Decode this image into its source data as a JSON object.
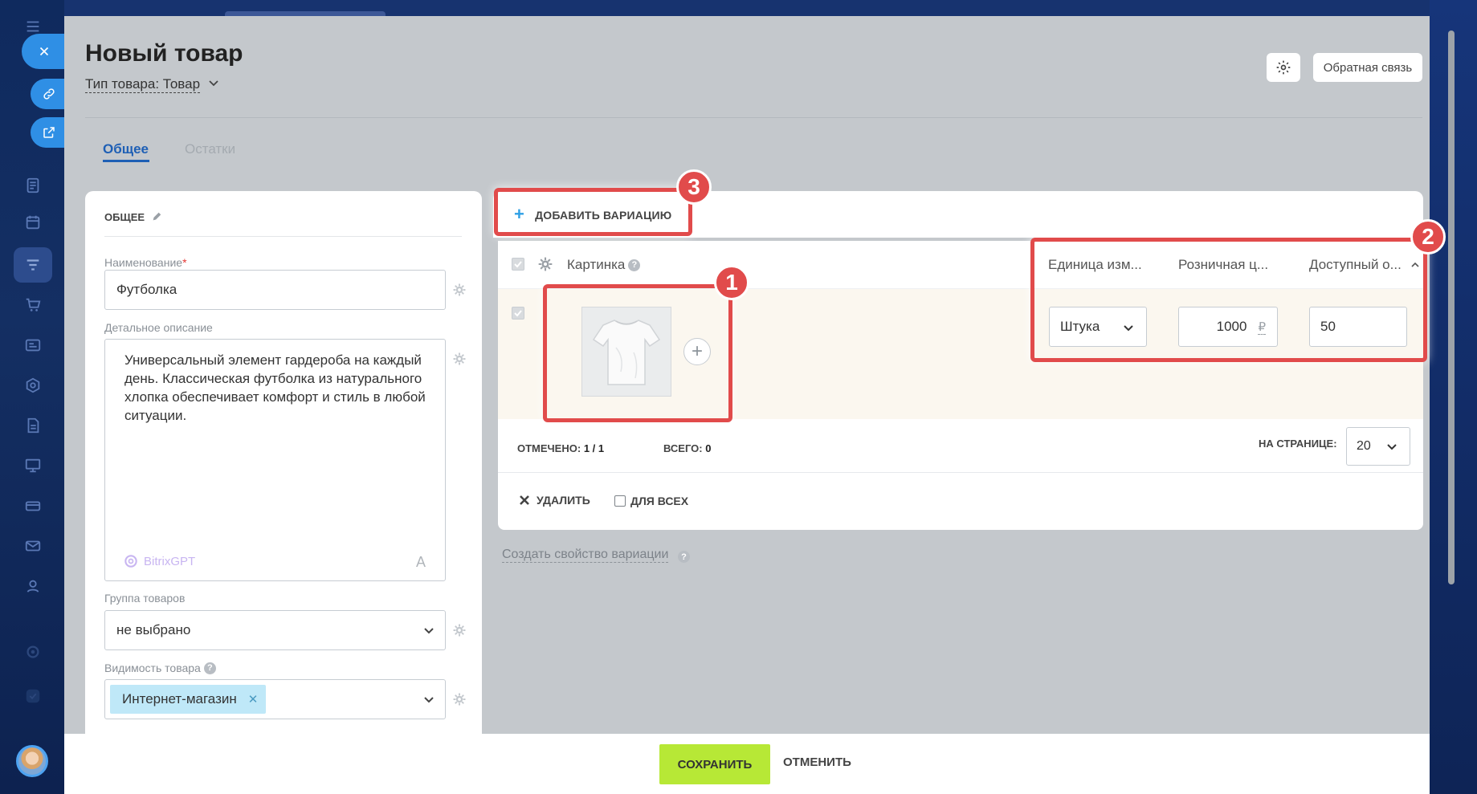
{
  "header": {
    "title": "Новый товар",
    "type_label": "Тип товара: Товар",
    "feedback_label": "Обратная связь"
  },
  "tabs": [
    {
      "label": "Общее",
      "active": true
    },
    {
      "label": "Остатки",
      "active": false
    }
  ],
  "general": {
    "section_title": "ОБЩЕЕ",
    "name_label": "Наименование",
    "name_required_mark": "*",
    "name_value": "Футболка",
    "description_label": "Детальное описание",
    "description_value": "Универсальный элемент гардероба на каждый день. Классическая футболка из натурального хлопка обеспечивает комфорт и стиль в любой ситуации.",
    "gpt_label": "BitrixGPT",
    "gpt_font_glyph": "A",
    "group_label": "Группа товаров",
    "group_value": "не выбрано",
    "visibility_label": "Видимость товара",
    "visibility_tag": "Интернет-магазин"
  },
  "variations": {
    "add_label": "ДОБАВИТЬ ВАРИАЦИЮ",
    "columns": {
      "picture": "Картинка",
      "unit": "Единица изм...",
      "price": "Розничная ц...",
      "available": "Доступный о..."
    },
    "row": {
      "unit": "Штука",
      "price": "1000",
      "currency": "₽",
      "available": "50"
    },
    "checked_label": "ОТМЕЧЕНО:",
    "checked_value": "1 / 1",
    "total_label": "ВСЕГО:",
    "total_value": "0",
    "per_page_label": "НА СТРАНИЦЕ:",
    "per_page_value": "20",
    "delete_label": "УДАЛИТЬ",
    "for_all_label": "ДЛЯ ВСЕХ",
    "create_property_label": "Создать свойство вариации"
  },
  "footer": {
    "save_label": "СОХРАНИТЬ",
    "cancel_label": "ОТМЕНИТЬ"
  },
  "annotations": [
    "1",
    "2",
    "3"
  ],
  "colors": {
    "accent_blue": "#2f8fe5",
    "save_green": "#b7e836",
    "annotation_red": "#e14b4b",
    "tab_active": "#1e5fb5"
  },
  "icons": [
    "close-icon",
    "link-icon",
    "external-link-icon",
    "gear-icon",
    "chevron-down-icon",
    "pencil-icon",
    "plus-icon",
    "help-icon",
    "checkbox-icon",
    "cross-icon",
    "tshirt-image"
  ]
}
